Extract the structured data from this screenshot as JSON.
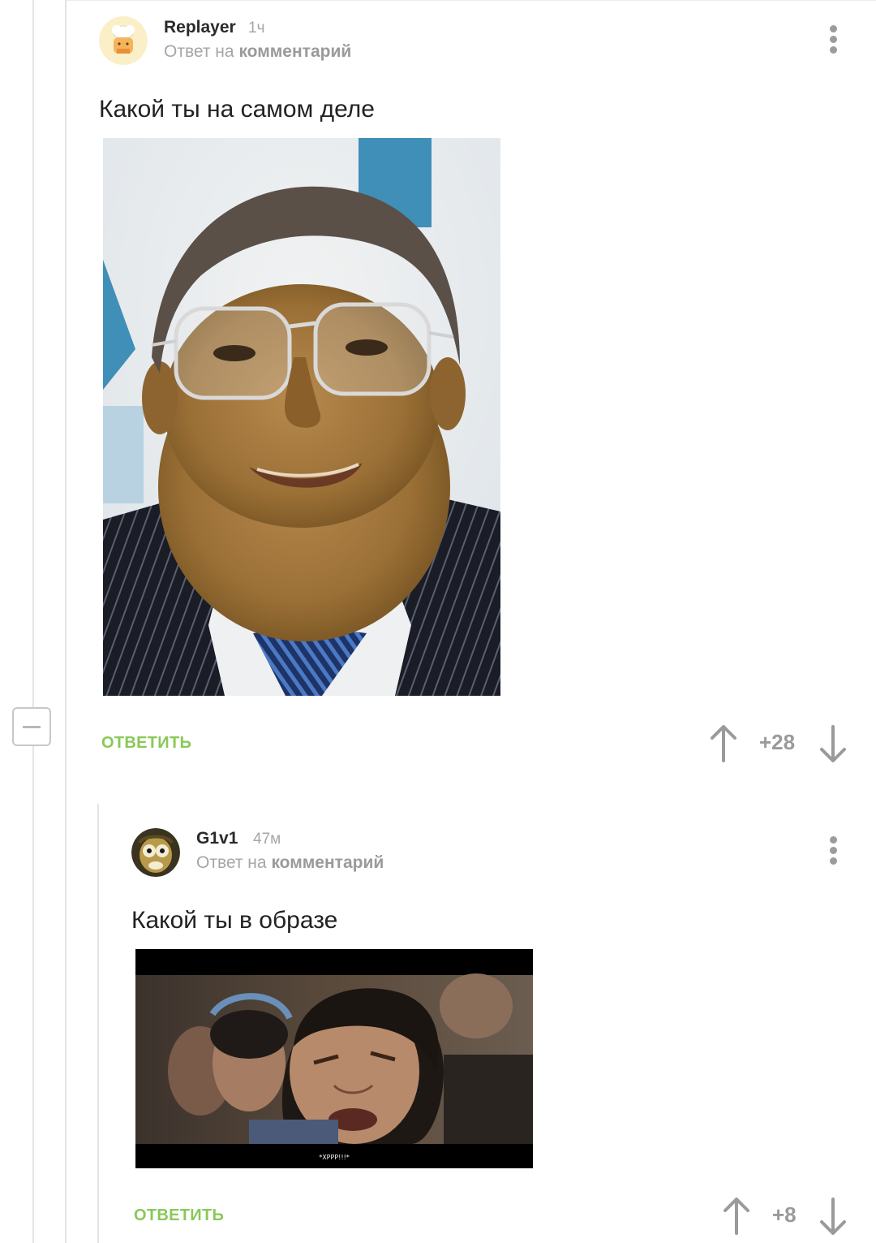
{
  "comments": [
    {
      "author": "Replayer",
      "time": "1ч",
      "reply_prefix": "Ответ на",
      "reply_link": "комментарий",
      "text": "Какой ты на самом деле",
      "reply_label": "ОТВЕТИТЬ",
      "rating": "+28"
    },
    {
      "author": "G1v1",
      "time": "47м",
      "reply_prefix": "Ответ на",
      "reply_link": "комментарий",
      "text": "Какой ты в образе",
      "reply_label": "ОТВЕТИТЬ",
      "rating": "+8",
      "image_caption": "*ХРРР!!!*"
    }
  ],
  "colors": {
    "accent_green": "#8ac858",
    "muted_gray": "#a6a6a6"
  },
  "icons": {
    "more": "kebab-menu-icon",
    "upvote": "arrow-up-icon",
    "downvote": "arrow-down-icon",
    "collapse": "minus-icon"
  }
}
